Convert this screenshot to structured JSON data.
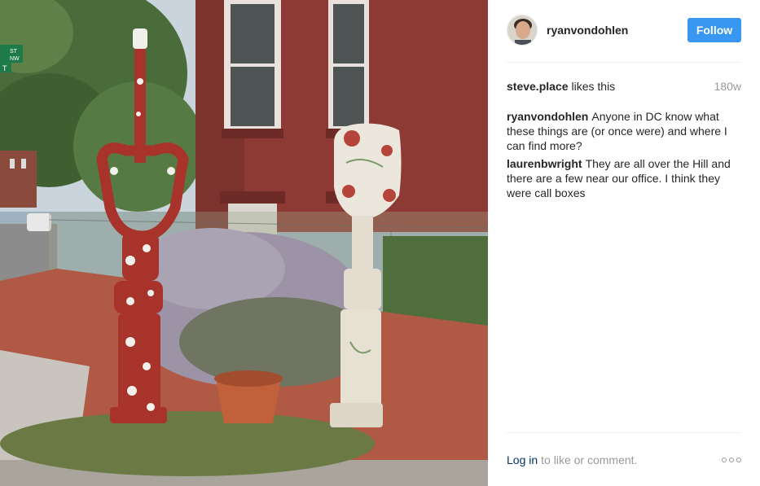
{
  "post": {
    "author": "ryanvondohlen",
    "follow_label": "Follow"
  },
  "likes": {
    "user": "steve.place",
    "text": "likes this",
    "age": "180w"
  },
  "comments": [
    {
      "user": "ryanvondohlen",
      "text": "Anyone in DC know what these things are (or once were) and where I can find more?"
    },
    {
      "user": "laurenbwright",
      "text": "They are all over the Hill and there are a few near our office. I think they were call boxes"
    }
  ],
  "footer": {
    "login_label": "Log in",
    "text": "to like or comment."
  },
  "photo": {
    "street_sign_line1": "ST",
    "street_sign_line2": "NW",
    "street_sign_partial": "T"
  },
  "colors": {
    "accent": "#3897f0",
    "link": "#003569",
    "muted": "#999999",
    "brick": "#8e3a34"
  },
  "icons": {
    "more": "more-dots-icon"
  }
}
